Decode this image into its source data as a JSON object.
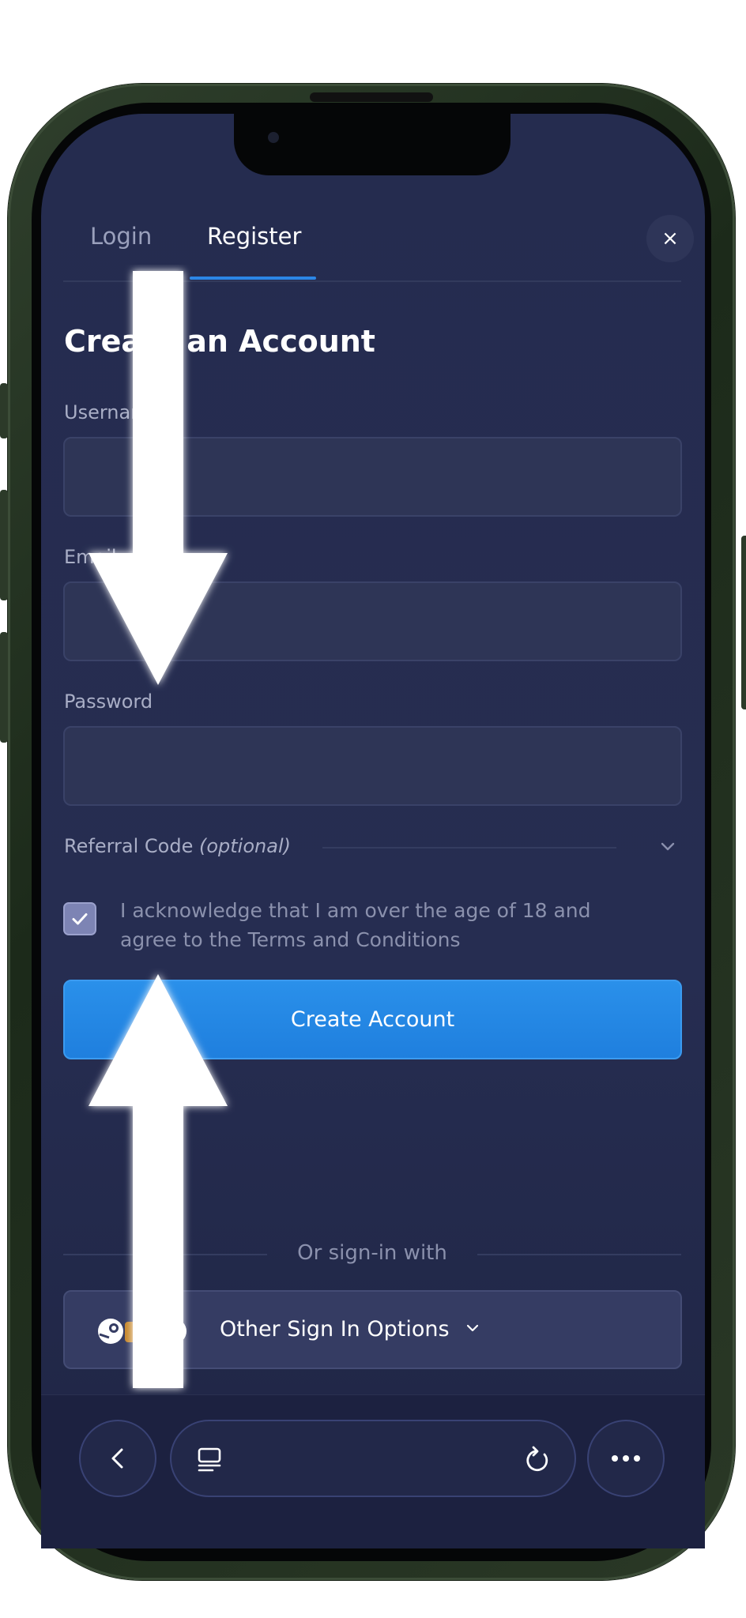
{
  "tabs": {
    "login": "Login",
    "register": "Register"
  },
  "close_label": "×",
  "form": {
    "title": "Create an Account",
    "username_label": "Username",
    "email_label": "Email",
    "password_label": "Password",
    "username_value": "",
    "email_value": "",
    "password_value": "",
    "referral_label": "Referral Code",
    "referral_optional": "(optional)",
    "acknowledge_checked": true,
    "acknowledge_text": "I acknowledge that I am over the age of 18 and agree to the Terms and Conditions",
    "submit_label": "Create Account"
  },
  "alt_signin": {
    "divider_text": "Or sign-in with",
    "button_label": "Other Sign In Options"
  },
  "colors": {
    "accent": "#2c86e6",
    "background": "#252c4f",
    "button": "#2a90ea"
  },
  "icons": {
    "close": "close-icon",
    "chevron": "chevron-down-icon",
    "check": "check-icon",
    "back": "chevron-left-icon",
    "tabs": "tabs-icon",
    "reload": "reload-icon",
    "more": "more-icon",
    "steam": "steam-icon"
  }
}
